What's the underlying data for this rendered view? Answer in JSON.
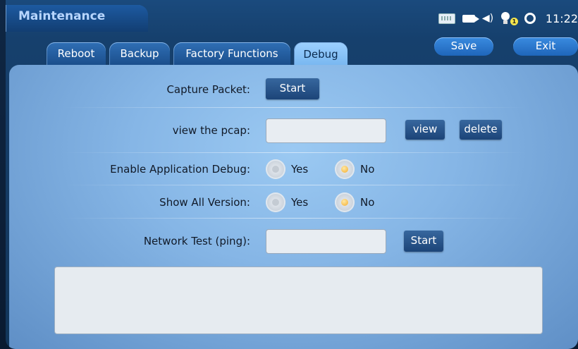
{
  "app": {
    "title": "Maintenance"
  },
  "status": {
    "notification_count": "1",
    "time": "11:22"
  },
  "tabs": [
    {
      "label": "Reboot",
      "active": false
    },
    {
      "label": "Backup",
      "active": false
    },
    {
      "label": "Factory Functions",
      "active": false
    },
    {
      "label": "Debug",
      "active": true
    }
  ],
  "actions": {
    "save_label": "Save",
    "exit_label": "Exit"
  },
  "debug": {
    "capture_packet": {
      "label": "Capture Packet:",
      "button": "Start"
    },
    "view_pcap": {
      "label": "view the pcap:",
      "value": "",
      "view_button": "view",
      "delete_button": "delete"
    },
    "app_debug": {
      "label": "Enable Application Debug:",
      "yes": "Yes",
      "no": "No",
      "selected": "No"
    },
    "show_version": {
      "label": "Show All Version:",
      "yes": "Yes",
      "no": "No",
      "selected": "No"
    },
    "network_test": {
      "label": "Network Test (ping):",
      "value": "",
      "button": "Start"
    },
    "output_text": ""
  }
}
